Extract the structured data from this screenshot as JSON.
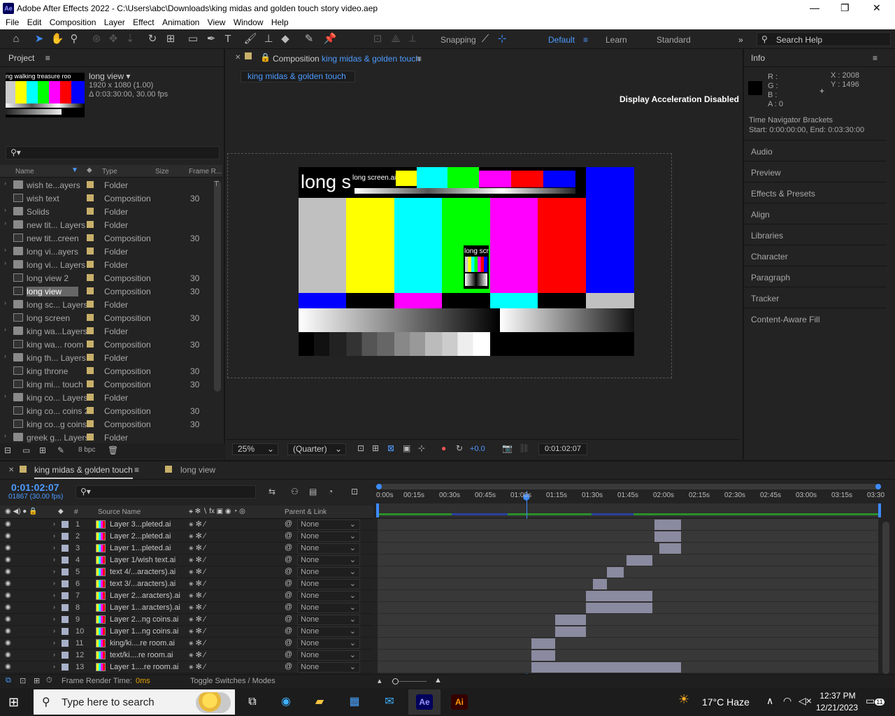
{
  "window": {
    "title": "Adobe After Effects 2022 - C:\\Users\\abc\\Downloads\\king midas and golden touch story video.aep",
    "logo": "Ae"
  },
  "menu": [
    "File",
    "Edit",
    "Composition",
    "Layer",
    "Effect",
    "Animation",
    "View",
    "Window",
    "Help"
  ],
  "toolbar": {
    "snapping_label": "Snapping",
    "workspaces": [
      "Default",
      "Learn",
      "Standard"
    ],
    "search_placeholder": "Search Help"
  },
  "project": {
    "title": "Project",
    "selected": {
      "name": "long view",
      "res": "1920 x 1080 (1.00)",
      "duration": "Δ 0:03:30:00, 30.00 fps",
      "thumb_text": "ng walking treasure roo"
    },
    "columns": {
      "name": "Name",
      "type": "Type",
      "size": "Size",
      "frame_rate": "Frame R..."
    },
    "items": [
      {
        "name": "wish te...ayers",
        "type": "Folder",
        "fps": ""
      },
      {
        "name": "wish text",
        "type": "Composition",
        "fps": "30"
      },
      {
        "name": "Solids",
        "type": "Folder",
        "fps": ""
      },
      {
        "name": "new tit... Layers",
        "type": "Folder",
        "fps": ""
      },
      {
        "name": "new tit...creen",
        "type": "Composition",
        "fps": "30"
      },
      {
        "name": "long vi...ayers",
        "type": "Folder",
        "fps": ""
      },
      {
        "name": "long vi... Layers",
        "type": "Folder",
        "fps": ""
      },
      {
        "name": "long view 2",
        "type": "Composition",
        "fps": "30"
      },
      {
        "name": "long view",
        "type": "Composition",
        "fps": "30"
      },
      {
        "name": "long sc... Layers",
        "type": "Folder",
        "fps": ""
      },
      {
        "name": "long screen",
        "type": "Composition",
        "fps": "30"
      },
      {
        "name": "king wa...Layers",
        "type": "Folder",
        "fps": ""
      },
      {
        "name": "king wa... room",
        "type": "Composition",
        "fps": "30"
      },
      {
        "name": "king th... Layers",
        "type": "Folder",
        "fps": ""
      },
      {
        "name": "king throne",
        "type": "Composition",
        "fps": "30"
      },
      {
        "name": "king mi... touch",
        "type": "Composition",
        "fps": "30"
      },
      {
        "name": "king co... Layers",
        "type": "Folder",
        "fps": ""
      },
      {
        "name": "king co... coins 2",
        "type": "Composition",
        "fps": "30"
      },
      {
        "name": "king co...g coins",
        "type": "Composition",
        "fps": "30"
      },
      {
        "name": "greek g... Layers",
        "type": "Folder",
        "fps": ""
      }
    ],
    "bpc": "8 bpc"
  },
  "composition": {
    "panel_prefix": "Composition",
    "name": "king midas & golden touch",
    "breadcrumb": "king midas & golden touch",
    "notice": "Display Acceleration Disabled",
    "canvas_title": "long s",
    "canvas_label1": "long screen.ai",
    "canvas_label2": "long scr",
    "zoom": "25%",
    "quality": "(Quarter)",
    "exposure": "+0.0",
    "timecode": "0:01:02:07"
  },
  "info": {
    "title": "Info",
    "rgba": [
      "R :",
      "G :",
      "B :",
      "A :  0"
    ],
    "x": "X : 2008",
    "y": "Y : 1496",
    "nav_title": "Time Navigator Brackets",
    "nav_range": "Start: 0:00:00:00, End: 0:03:30:00",
    "panels": [
      "Audio",
      "Preview",
      "Effects & Presets",
      "Align",
      "Libraries",
      "Character",
      "Paragraph",
      "Tracker",
      "Content-Aware Fill"
    ]
  },
  "timeline": {
    "tabs": [
      "king midas & golden touch",
      "long view"
    ],
    "timecode": "0:01:02:07",
    "frame": "01867 (30.00 fps)",
    "col_source": "Source Name",
    "col_parent": "Parent & Link",
    "ticks": [
      "0:00s",
      "00:15s",
      "00:30s",
      "00:45s",
      "01:00s",
      "01:15s",
      "01:30s",
      "01:45s",
      "02:00s",
      "02:15s",
      "02:30s",
      "02:45s",
      "03:00s",
      "03:15s",
      "03:30"
    ],
    "playhead_seconds": 62.2,
    "duration_seconds": 210,
    "layers": [
      {
        "num": "1",
        "name": "Layer 3...pleted.ai",
        "parent": "None",
        "in": 116,
        "out": 127
      },
      {
        "num": "2",
        "name": "Layer 2...pleted.ai",
        "parent": "None",
        "in": 116,
        "out": 127
      },
      {
        "num": "3",
        "name": "Layer 1...pleted.ai",
        "parent": "None",
        "in": 118,
        "out": 127
      },
      {
        "num": "4",
        "name": "Layer 1/wish text.ai",
        "parent": "None",
        "in": 104,
        "out": 115
      },
      {
        "num": "5",
        "name": "text 4/...aracters).ai",
        "parent": "None",
        "in": 96,
        "out": 103
      },
      {
        "num": "6",
        "name": "text 3/...aracters).ai",
        "parent": "None",
        "in": 90,
        "out": 96
      },
      {
        "num": "7",
        "name": "Layer 2...aracters).ai",
        "parent": "None",
        "in": 87,
        "out": 115
      },
      {
        "num": "8",
        "name": "Layer 1...aracters).ai",
        "parent": "None",
        "in": 87,
        "out": 115
      },
      {
        "num": "9",
        "name": "Layer 2...ng coins.ai",
        "parent": "None",
        "in": 74,
        "out": 87
      },
      {
        "num": "10",
        "name": "Layer 1...ng coins.ai",
        "parent": "None",
        "in": 74,
        "out": 87
      },
      {
        "num": "11",
        "name": "king/ki....re room.ai",
        "parent": "None",
        "in": 64,
        "out": 74
      },
      {
        "num": "12",
        "name": "text/ki....re room.ai",
        "parent": "None",
        "in": 64,
        "out": 74
      },
      {
        "num": "13",
        "name": "Layer 1....re room.ai",
        "parent": "None",
        "in": 64,
        "out": 127
      }
    ],
    "footer_render": "Frame Render Time:",
    "footer_render_val": "0ms",
    "footer_toggle": "Toggle Switches / Modes"
  },
  "taskbar": {
    "search_placeholder": "Type here to search",
    "weather": "17°C  Haze",
    "time": "12:37 PM",
    "date": "12/21/2023",
    "notifications": "11"
  }
}
